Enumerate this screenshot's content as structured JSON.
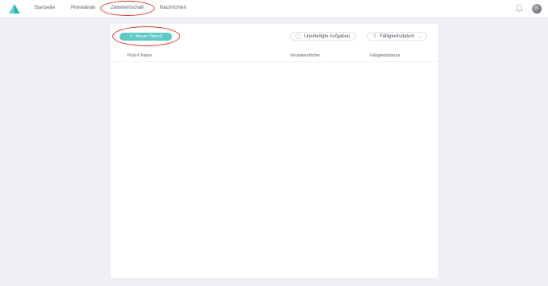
{
  "nav": {
    "items": [
      {
        "label": "Startseite"
      },
      {
        "label": "Pinnwände"
      },
      {
        "label": "Zettelwirtschaft"
      },
      {
        "label": "Nachrichten"
      }
    ]
  },
  "toolbar": {
    "new_button_label": "Neuer Post-It",
    "filter_label": "Unerledigte Aufgaben",
    "sort_label": "Fälligkeitsdatum"
  },
  "table": {
    "columns": [
      "Post-It Name",
      "Verantwortlicher",
      "Fälligkeitsdatum"
    ],
    "rows": []
  },
  "colors": {
    "accent": "#5fc9c3",
    "logo": "#3ec9c2",
    "annotation": "#d8352b",
    "background": "#eef0f5"
  },
  "icons": {
    "logo": "sail-logo",
    "notifications": "bell-icon",
    "user": "avatar"
  }
}
